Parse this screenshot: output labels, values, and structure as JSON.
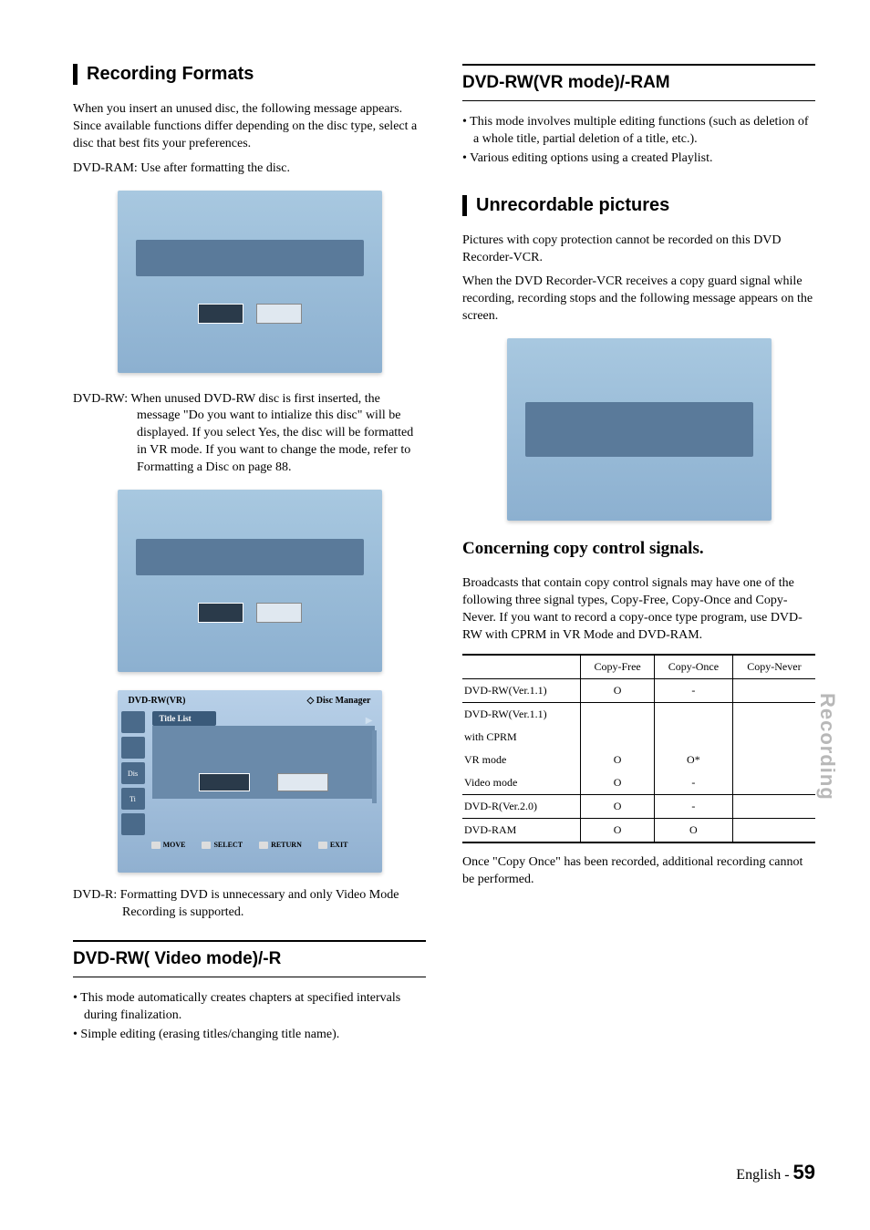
{
  "left": {
    "title1": "Recording Formats",
    "intro": "When you insert an unused disc, the following message appears. Since available functions differ depending on the disc type, select a disc that best fits your preferences.",
    "ram_note": "DVD-RAM: Use after formatting the disc.",
    "rw_note": "DVD-RW: When unused DVD-RW disc is first inserted, the message \"Do you want to intialize this disc\" will be displayed. If you select Yes, the disc will be formatted in VR mode. If you want to change the mode, refer to Formatting a Disc on page 88.",
    "r_note": "DVD-R: Formatting DVD is unnecessary and only Video Mode Recording is supported.",
    "disc_manager": {
      "mode": "DVD-RW(VR)",
      "label": "Disc Manager",
      "title_list": "Title List",
      "side_icons": [
        "",
        "",
        "Dis",
        "Ti",
        ""
      ],
      "footer": {
        "move": "MOVE",
        "select": "SELECT",
        "return": "RETURN",
        "exit": "EXIT"
      }
    },
    "subsection1": "DVD-RW( Video mode)/-R",
    "bullets1": [
      "This mode automatically creates chapters at specified intervals during finalization.",
      "Simple editing (erasing titles/changing title name)."
    ]
  },
  "right": {
    "subsection2": "DVD-RW(VR mode)/-RAM",
    "bullets2": [
      "This mode involves multiple editing functions (such as deletion of a whole title, partial deletion of a title, etc.).",
      "Various editing options using a created Playlist."
    ],
    "title2": "Unrecordable pictures",
    "para1": "Pictures with copy protection cannot be recorded on this DVD Recorder-VCR.",
    "para2": "When the DVD Recorder-VCR receives a copy guard signal while recording, recording stops and the following message appears on the screen.",
    "heading2": "Concerning copy control signals.",
    "para3": "Broadcasts that contain copy control signals may have one of the following three signal types, Copy-Free, Copy-Once and Copy-Never. If you want to record a copy-once type program, use DVD-RW with CPRM in VR Mode and DVD-RAM.",
    "table": {
      "headers": [
        "",
        "Copy-Free",
        "Copy-Once",
        "Copy-Never"
      ],
      "rows": [
        [
          "DVD-RW(Ver.1.1)",
          "O",
          "-",
          ""
        ],
        [
          "DVD-RW(Ver.1.1)",
          "",
          "",
          ""
        ],
        [
          "with CPRM",
          "",
          "",
          ""
        ],
        [
          "VR mode",
          "O",
          "O*",
          ""
        ],
        [
          "Video mode",
          "O",
          "-",
          ""
        ],
        [
          "DVD-R(Ver.2.0)",
          "O",
          "-",
          ""
        ],
        [
          "DVD-RAM",
          "O",
          "O",
          ""
        ]
      ]
    },
    "para4": "Once \"Copy Once\" has been recorded, additional recording cannot be performed."
  },
  "sidetab": "Recording",
  "footer": {
    "lang": "English -",
    "page": "59"
  }
}
